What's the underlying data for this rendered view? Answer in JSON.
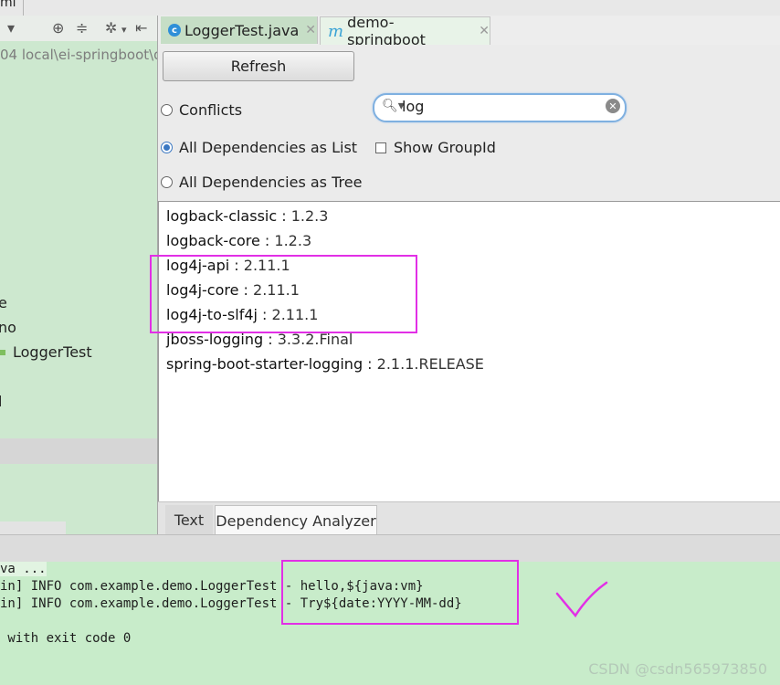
{
  "topbar": {
    "crumb": "ml"
  },
  "project": {
    "path": "04 local\\ei-springboot\\d",
    "tree_items": [
      "e",
      "no",
      "LoggerTest",
      "l"
    ]
  },
  "tabs": [
    {
      "label": "LoggerTest.java",
      "icon": "class-c-icon"
    },
    {
      "label": "demo-springboot",
      "icon": "maven-m-icon"
    }
  ],
  "analyzer": {
    "refresh_label": "Refresh",
    "options": {
      "conflicts": "Conflicts",
      "as_list": "All Dependencies as List",
      "as_tree": "All Dependencies as Tree",
      "selected": "as_list"
    },
    "search": {
      "value": "log"
    },
    "show_group_id": "Show GroupId",
    "dependencies": [
      {
        "name": "logback-classic",
        "version": "1.2.3"
      },
      {
        "name": "logback-core",
        "version": "1.2.3"
      },
      {
        "name": "log4j-api",
        "version": "2.11.1"
      },
      {
        "name": "log4j-core",
        "version": "2.11.1"
      },
      {
        "name": "log4j-to-slf4j",
        "version": "2.11.1"
      },
      {
        "name": "jboss-logging",
        "version": "3.3.2.Final"
      },
      {
        "name": "spring-boot-starter-logging",
        "version": "2.1.1.RELEASE"
      }
    ],
    "bottom_tabs": [
      "Text",
      "Dependency Analyzer"
    ]
  },
  "console": {
    "lines": [
      "va ...",
      "in] INFO com.example.demo.LoggerTest - hello,${java:vm}",
      "in] INFO com.example.demo.LoggerTest - Try${date:YYYY-MM-dd}",
      "",
      " with exit code 0"
    ]
  },
  "watermark": "CSDN @csdn565973850",
  "colors": {
    "highlight": "#e22fe6",
    "console_bg": "#c8ecca",
    "project_bg": "#cde8cf"
  }
}
